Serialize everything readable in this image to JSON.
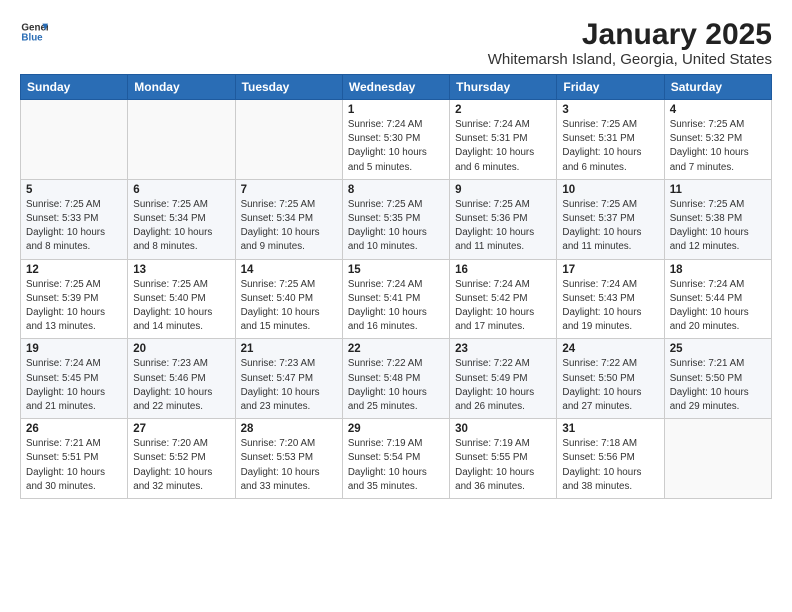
{
  "header": {
    "logo_line1": "General",
    "logo_line2": "Blue",
    "title": "January 2025",
    "subtitle": "Whitemarsh Island, Georgia, United States"
  },
  "days_of_week": [
    "Sunday",
    "Monday",
    "Tuesday",
    "Wednesday",
    "Thursday",
    "Friday",
    "Saturday"
  ],
  "weeks": [
    [
      {
        "day": "",
        "info": ""
      },
      {
        "day": "",
        "info": ""
      },
      {
        "day": "",
        "info": ""
      },
      {
        "day": "1",
        "info": "Sunrise: 7:24 AM\nSunset: 5:30 PM\nDaylight: 10 hours\nand 5 minutes."
      },
      {
        "day": "2",
        "info": "Sunrise: 7:24 AM\nSunset: 5:31 PM\nDaylight: 10 hours\nand 6 minutes."
      },
      {
        "day": "3",
        "info": "Sunrise: 7:25 AM\nSunset: 5:31 PM\nDaylight: 10 hours\nand 6 minutes."
      },
      {
        "day": "4",
        "info": "Sunrise: 7:25 AM\nSunset: 5:32 PM\nDaylight: 10 hours\nand 7 minutes."
      }
    ],
    [
      {
        "day": "5",
        "info": "Sunrise: 7:25 AM\nSunset: 5:33 PM\nDaylight: 10 hours\nand 8 minutes."
      },
      {
        "day": "6",
        "info": "Sunrise: 7:25 AM\nSunset: 5:34 PM\nDaylight: 10 hours\nand 8 minutes."
      },
      {
        "day": "7",
        "info": "Sunrise: 7:25 AM\nSunset: 5:34 PM\nDaylight: 10 hours\nand 9 minutes."
      },
      {
        "day": "8",
        "info": "Sunrise: 7:25 AM\nSunset: 5:35 PM\nDaylight: 10 hours\nand 10 minutes."
      },
      {
        "day": "9",
        "info": "Sunrise: 7:25 AM\nSunset: 5:36 PM\nDaylight: 10 hours\nand 11 minutes."
      },
      {
        "day": "10",
        "info": "Sunrise: 7:25 AM\nSunset: 5:37 PM\nDaylight: 10 hours\nand 11 minutes."
      },
      {
        "day": "11",
        "info": "Sunrise: 7:25 AM\nSunset: 5:38 PM\nDaylight: 10 hours\nand 12 minutes."
      }
    ],
    [
      {
        "day": "12",
        "info": "Sunrise: 7:25 AM\nSunset: 5:39 PM\nDaylight: 10 hours\nand 13 minutes."
      },
      {
        "day": "13",
        "info": "Sunrise: 7:25 AM\nSunset: 5:40 PM\nDaylight: 10 hours\nand 14 minutes."
      },
      {
        "day": "14",
        "info": "Sunrise: 7:25 AM\nSunset: 5:40 PM\nDaylight: 10 hours\nand 15 minutes."
      },
      {
        "day": "15",
        "info": "Sunrise: 7:24 AM\nSunset: 5:41 PM\nDaylight: 10 hours\nand 16 minutes."
      },
      {
        "day": "16",
        "info": "Sunrise: 7:24 AM\nSunset: 5:42 PM\nDaylight: 10 hours\nand 17 minutes."
      },
      {
        "day": "17",
        "info": "Sunrise: 7:24 AM\nSunset: 5:43 PM\nDaylight: 10 hours\nand 19 minutes."
      },
      {
        "day": "18",
        "info": "Sunrise: 7:24 AM\nSunset: 5:44 PM\nDaylight: 10 hours\nand 20 minutes."
      }
    ],
    [
      {
        "day": "19",
        "info": "Sunrise: 7:24 AM\nSunset: 5:45 PM\nDaylight: 10 hours\nand 21 minutes."
      },
      {
        "day": "20",
        "info": "Sunrise: 7:23 AM\nSunset: 5:46 PM\nDaylight: 10 hours\nand 22 minutes."
      },
      {
        "day": "21",
        "info": "Sunrise: 7:23 AM\nSunset: 5:47 PM\nDaylight: 10 hours\nand 23 minutes."
      },
      {
        "day": "22",
        "info": "Sunrise: 7:22 AM\nSunset: 5:48 PM\nDaylight: 10 hours\nand 25 minutes."
      },
      {
        "day": "23",
        "info": "Sunrise: 7:22 AM\nSunset: 5:49 PM\nDaylight: 10 hours\nand 26 minutes."
      },
      {
        "day": "24",
        "info": "Sunrise: 7:22 AM\nSunset: 5:50 PM\nDaylight: 10 hours\nand 27 minutes."
      },
      {
        "day": "25",
        "info": "Sunrise: 7:21 AM\nSunset: 5:50 PM\nDaylight: 10 hours\nand 29 minutes."
      }
    ],
    [
      {
        "day": "26",
        "info": "Sunrise: 7:21 AM\nSunset: 5:51 PM\nDaylight: 10 hours\nand 30 minutes."
      },
      {
        "day": "27",
        "info": "Sunrise: 7:20 AM\nSunset: 5:52 PM\nDaylight: 10 hours\nand 32 minutes."
      },
      {
        "day": "28",
        "info": "Sunrise: 7:20 AM\nSunset: 5:53 PM\nDaylight: 10 hours\nand 33 minutes."
      },
      {
        "day": "29",
        "info": "Sunrise: 7:19 AM\nSunset: 5:54 PM\nDaylight: 10 hours\nand 35 minutes."
      },
      {
        "day": "30",
        "info": "Sunrise: 7:19 AM\nSunset: 5:55 PM\nDaylight: 10 hours\nand 36 minutes."
      },
      {
        "day": "31",
        "info": "Sunrise: 7:18 AM\nSunset: 5:56 PM\nDaylight: 10 hours\nand 38 minutes."
      },
      {
        "day": "",
        "info": ""
      }
    ]
  ]
}
